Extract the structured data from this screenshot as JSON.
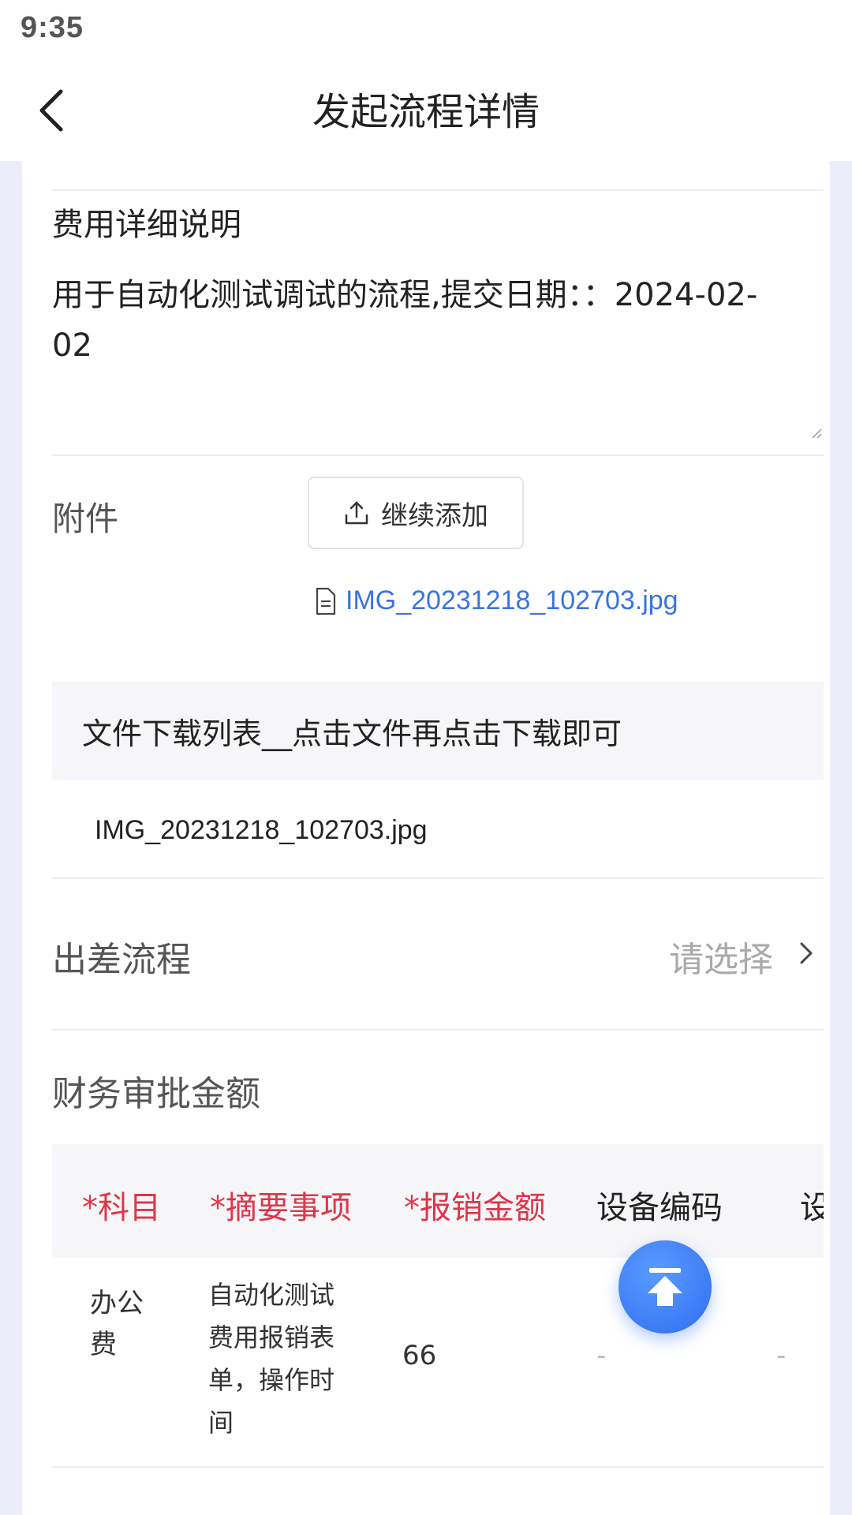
{
  "status_bar": {
    "time": "9:35"
  },
  "header": {
    "title": "发起流程详情"
  },
  "description": {
    "label": "费用详细说明",
    "text": "用于自动化测试调试的流程,提交日期：：2024-02-02"
  },
  "attachment": {
    "label": "附件",
    "add_button": "继续添加",
    "file_name": "IMG_20231218_102703.jpg"
  },
  "download_list": {
    "title": "文件下载列表__点击文件再点击下载即可",
    "items": [
      "IMG_20231218_102703.jpg"
    ]
  },
  "trip": {
    "label": "出差流程",
    "placeholder": "请选择"
  },
  "finance": {
    "label": "财务审批金额",
    "columns": [
      "*科目",
      "*摘要事项",
      "*报销金额",
      "设备编码",
      "设"
    ],
    "rows": [
      {
        "subject": "办公费",
        "summary": "自动化测试费用报销表单，操作时间",
        "amount": "66",
        "device_code": "-",
        "extra": "-"
      }
    ]
  },
  "colors": {
    "accent": "#3a74e0",
    "required": "#e0354a",
    "page_bg": "#ededfa"
  },
  "icons": [
    "back-arrow-icon",
    "upload-icon",
    "file-icon",
    "chevron-right-icon",
    "back-to-top-icon"
  ]
}
